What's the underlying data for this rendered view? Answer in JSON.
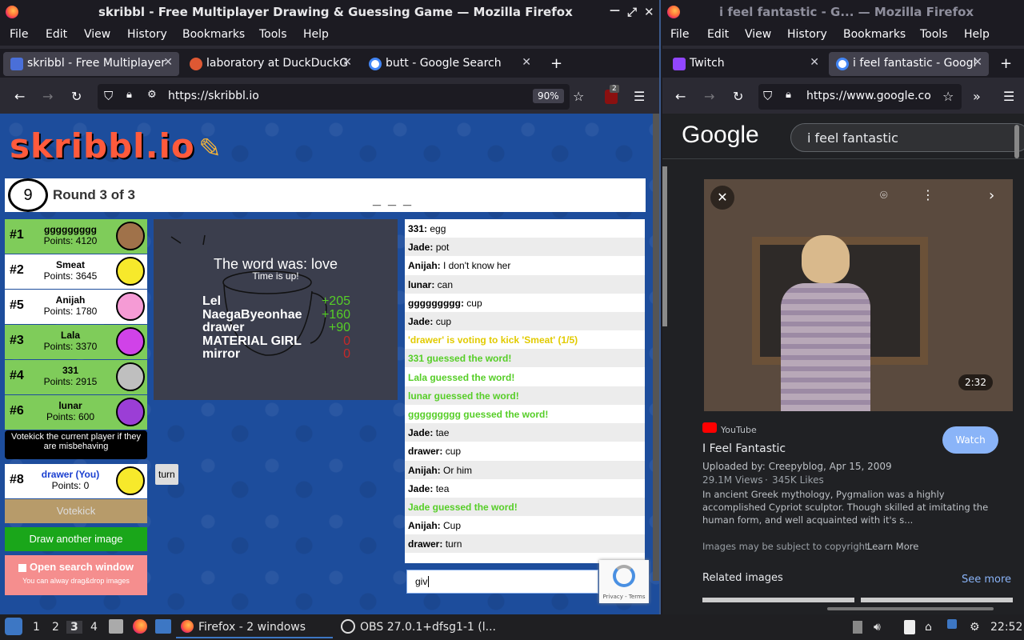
{
  "left_window": {
    "title": "skribbl - Free Multiplayer Drawing & Guessing Game — Mozilla Firefox",
    "menu": [
      "File",
      "Edit",
      "View",
      "History",
      "Bookmarks",
      "Tools",
      "Help"
    ],
    "tabs": [
      {
        "label": "skribbl - Free Multiplayer",
        "active": true
      },
      {
        "label": "laboratory at DuckDuckG",
        "active": false
      },
      {
        "label": "butt - Google Search",
        "active": false
      }
    ],
    "url": "https://skribbl.io",
    "zoom": "90%",
    "ext_badge": "2"
  },
  "skribbl": {
    "logo": "skribbl.io",
    "timer": "9",
    "round": "Round 3 of 3",
    "word_hint": "_ _ _",
    "players": [
      {
        "rank": "#1",
        "name": "ggggggggg",
        "points": "Points: 4120",
        "color": "#7fcc5a",
        "avatar": "#a0724a"
      },
      {
        "rank": "#2",
        "name": "Smeat",
        "points": "Points: 3645",
        "color": "#ffffff",
        "avatar": "#f7e92b"
      },
      {
        "rank": "#5",
        "name": "Anijah",
        "points": "Points: 1780",
        "color": "#ffffff",
        "avatar": "#f59bd5"
      },
      {
        "rank": "#3",
        "name": "Lala",
        "points": "Points: 3370",
        "color": "#7fcc5a",
        "avatar": "#d042e8"
      },
      {
        "rank": "#4",
        "name": "331",
        "points": "Points: 2915",
        "color": "#7fcc5a",
        "avatar": "#bfbfbf"
      },
      {
        "rank": "#6",
        "name": "lunar",
        "points": "Points: 600",
        "color": "#7fcc5a",
        "avatar": "#9b3ed6"
      },
      {
        "rank": "#8",
        "name": "drawer (You)",
        "points": "Points: 0",
        "color": "#ffffff",
        "avatar": "#f7e92b"
      }
    ],
    "votekick_tooltip": "Votekick the current player if they are misbehaving",
    "turn_label": "turn",
    "votekick_button": "Votekick",
    "draw_another_button": "Draw another image",
    "open_search_label": "Open search window",
    "open_search_sub": "You can alway drag&drop images",
    "word_reveal": "The word was: love",
    "time_up": "Time is up!",
    "results": [
      {
        "name": "Lel",
        "score": "+205"
      },
      {
        "name": "NaegaByeonhae",
        "score": "+160"
      },
      {
        "name": "drawer",
        "score": "+90"
      },
      {
        "name": "MATERIAL GIRL",
        "score": "0"
      },
      {
        "name": "mirror",
        "score": "0"
      }
    ],
    "chat": [
      {
        "user": "331:",
        "text": " egg",
        "type": "msg"
      },
      {
        "user": "Jade:",
        "text": " pot",
        "type": "msg"
      },
      {
        "user": "Anijah:",
        "text": " I don't know her",
        "type": "msg"
      },
      {
        "user": "lunar:",
        "text": " can",
        "type": "msg"
      },
      {
        "user": "ggggggggg:",
        "text": " cup",
        "type": "msg"
      },
      {
        "user": "Jade:",
        "text": " cup",
        "type": "msg"
      },
      {
        "user": "",
        "text": "'drawer' is voting to kick 'Smeat' (1/5)",
        "type": "vote"
      },
      {
        "user": "",
        "text": "331 guessed the word!",
        "type": "guess"
      },
      {
        "user": "",
        "text": "Lala guessed the word!",
        "type": "guess"
      },
      {
        "user": "",
        "text": "lunar guessed the word!",
        "type": "guess"
      },
      {
        "user": "",
        "text": "ggggggggg guessed the word!",
        "type": "guess"
      },
      {
        "user": "Jade:",
        "text": " tae",
        "type": "msg"
      },
      {
        "user": "drawer:",
        "text": " cup",
        "type": "msg"
      },
      {
        "user": "Anijah:",
        "text": " Or him",
        "type": "msg"
      },
      {
        "user": "Jade:",
        "text": " tea",
        "type": "msg"
      },
      {
        "user": "",
        "text": "Jade guessed the word!",
        "type": "guess"
      },
      {
        "user": "Anijah:",
        "text": " Cup",
        "type": "msg"
      },
      {
        "user": "drawer:",
        "text": " turn",
        "type": "msg"
      }
    ],
    "chat_input": "giv",
    "recaptcha_links": "Privacy - Terms"
  },
  "right_window": {
    "title": "i feel fantastic - G... — Mozilla Firefox",
    "menu": [
      "File",
      "Edit",
      "View",
      "History",
      "Bookmarks",
      "Tools",
      "Help"
    ],
    "tabs": [
      {
        "label": "Twitch",
        "active": false
      },
      {
        "label": "i feel fantastic - Googl",
        "active": true
      }
    ],
    "url": "https://www.google.co",
    "search_query": "i feel fantastic",
    "google_logo": "Google",
    "video_duration": "2:32",
    "source": "YouTube",
    "result_title": "I Feel Fantastic",
    "uploaded": "Uploaded by: Creepyblog, Apr 15, 2009",
    "views": "29.1M Views",
    "likes": "345K Likes",
    "description": "In ancient Greek mythology, Pygmalion was a highly accomplished Cypriot sculptor. Though skilled at imitating the human form, and well acquainted with it's s...",
    "watch_button": "Watch",
    "copyright": "Images may be subject to copyright.",
    "learn_more": "Learn More",
    "related": "Related images",
    "see_more": "See more"
  },
  "taskbar": {
    "workspaces": [
      "1",
      "2",
      "3",
      "4"
    ],
    "firefox_task": "Firefox - 2 windows",
    "obs_task": "OBS 27.0.1+dfsg1-1 (l...",
    "clock": "22:52"
  }
}
